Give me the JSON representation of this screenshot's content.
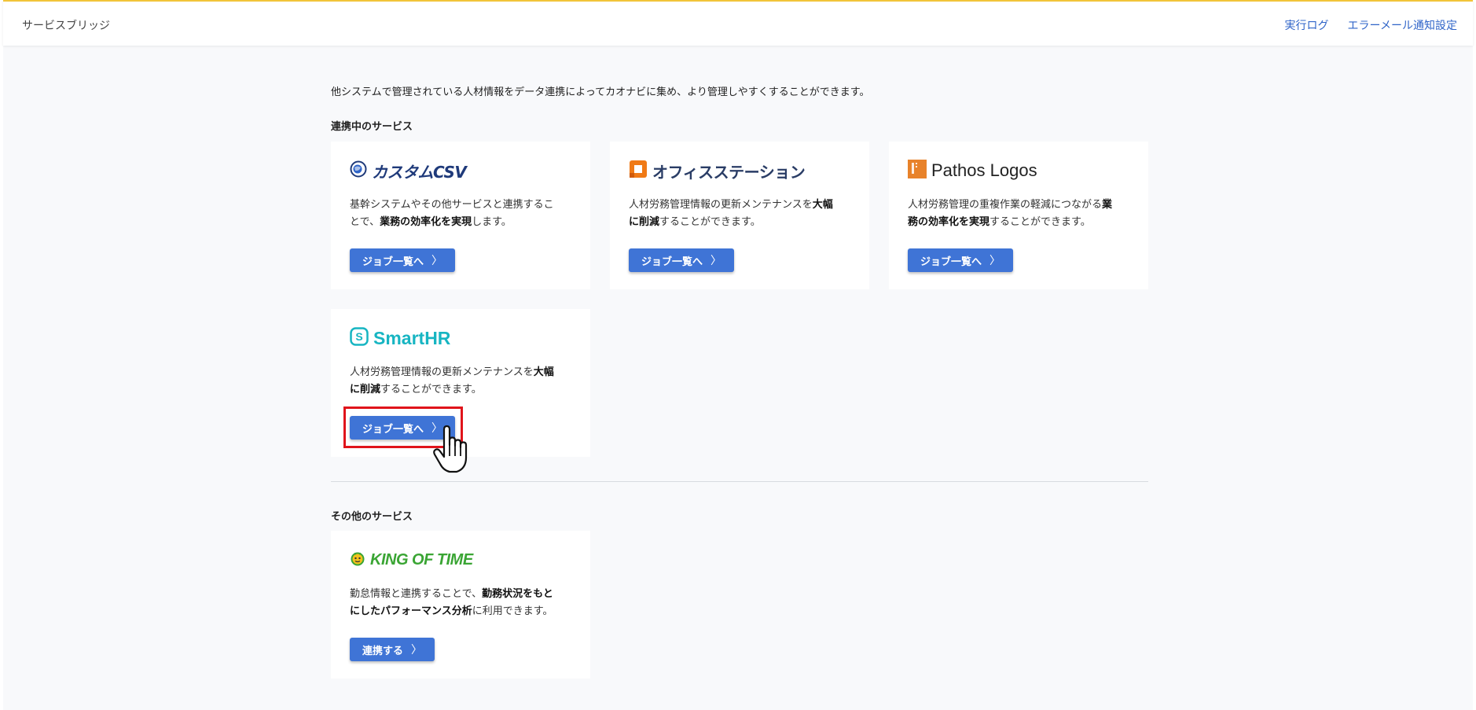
{
  "header": {
    "brand": "サービスブリッジ",
    "nav": [
      {
        "label": "実行ログ"
      },
      {
        "label": "エラーメール通知設定"
      }
    ]
  },
  "intro": "他システムで管理されている人材情報をデータ連携によってカオナビに集め、より管理しやすくすることができます。",
  "connected": {
    "title": "連携中のサービス",
    "cards": [
      {
        "logo_text": "カスタムCSV",
        "logo_icon": "globe-icon",
        "desc_1": "基幹システムやその他サービスと連携するこ",
        "desc_2a": "とで、",
        "desc_2b": "業務の効率化を実現",
        "desc_2c": "します。",
        "button": "ジョブ一覧へ"
      },
      {
        "logo_text": "オフィスステーション",
        "logo_icon": "square-icon",
        "desc_1a": "人材労務管理情報の更新メンテナンスを",
        "desc_1b": "大幅",
        "desc_2a": "に削減",
        "desc_2b": "することができます。",
        "button": "ジョブ一覧へ"
      },
      {
        "logo_text_a": "Pathos",
        "logo_text_b": "Logos",
        "logo_icon": "pathos-square-icon",
        "desc_1a": "人材労務管理の重複作業の軽減につながる",
        "desc_1b": "業",
        "desc_2a": "務の効率化を実現",
        "desc_2b": "することができます。",
        "button": "ジョブ一覧へ"
      },
      {
        "logo_text": "SmartHR",
        "logo_icon": "smarthr-s-icon",
        "desc_1a": "人材労務管理情報の更新メンテナンスを",
        "desc_1b": "大幅",
        "desc_2a": "に削減",
        "desc_2b": "することができます。",
        "button": "ジョブ一覧へ"
      }
    ]
  },
  "other": {
    "title": "その他のサービス",
    "cards": [
      {
        "logo_text": "KING OF TIME",
        "logo_icon": "clock-face-icon",
        "desc_1a": "勤怠情報と連携することで、",
        "desc_1b": "勤務状況をもと",
        "desc_2a": "にしたパフォーマンス分析",
        "desc_2b": "に利用できます。",
        "button": "連携する"
      }
    ]
  },
  "chevron": "〉",
  "colors": {
    "accent": "#3f74d6",
    "link": "#2f64c8",
    "top_border": "#f2c43a",
    "highlight": "#e0141b"
  }
}
